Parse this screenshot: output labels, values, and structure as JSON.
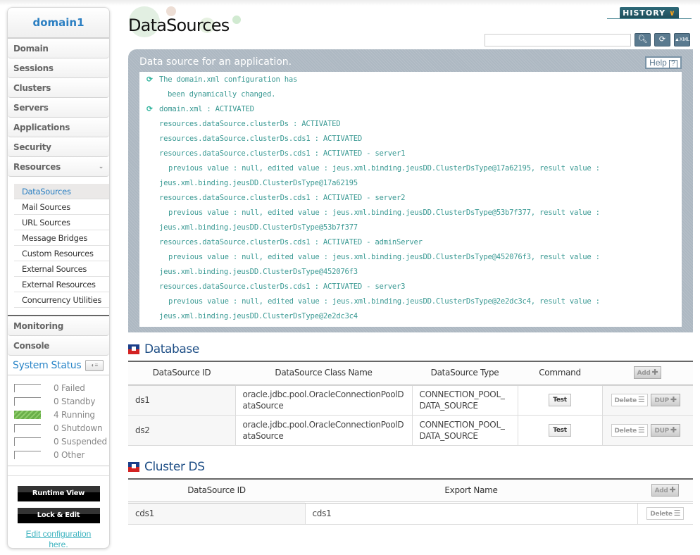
{
  "sidebar": {
    "domain": "domain1",
    "nav_top": [
      "Domain",
      "Sessions",
      "Clusters",
      "Servers",
      "Applications",
      "Security",
      "Resources"
    ],
    "resources_sub": [
      "DataSources",
      "Mail Sources",
      "URL Sources",
      "Message Bridges",
      "Custom Resources",
      "External Sources",
      "External Resources",
      "Concurrency Utilities"
    ],
    "active_sub": "DataSources",
    "nav_bottom": [
      "Monitoring",
      "Console"
    ],
    "system_status": {
      "title": "System Status",
      "rows": [
        {
          "count": 0,
          "label": "0 Failed"
        },
        {
          "count": 0,
          "label": "0 Standby"
        },
        {
          "count": 4,
          "label": "4 Running"
        },
        {
          "count": 0,
          "label": "0 Shutdown"
        },
        {
          "count": 0,
          "label": "0 Suspended"
        },
        {
          "count": 0,
          "label": "0 Other"
        }
      ]
    },
    "runtime_view": "Runtime View",
    "lock_edit": "Lock & Edit",
    "edit_link_1": "Edit configuration",
    "edit_link_2": "here."
  },
  "header": {
    "title": "DataSources",
    "history": "HISTORY",
    "search_value": ""
  },
  "info": {
    "title": "Data source for an application.",
    "help": "Help",
    "lines": [
      {
        "icon": true,
        "text": "The domain.xml configuration has"
      },
      {
        "icon": false,
        "indent": 2,
        "text": "been dynamically changed."
      },
      {
        "icon": true,
        "text": "domain.xml : ACTIVATED"
      },
      {
        "icon": false,
        "indent": 1,
        "text": "resources.dataSource.clusterDs : ACTIVATED"
      },
      {
        "icon": false,
        "indent": 1,
        "text": "resources.dataSource.clusterDs.cds1 : ACTIVATED"
      },
      {
        "icon": false,
        "indent": 1,
        "text": "resources.dataSource.clusterDs.cds1 : ACTIVATED - server1"
      },
      {
        "icon": false,
        "indent": 3,
        "text": "previous value : null, edited value : jeus.xml.binding.jeusDD.ClusterDsType@17a62195, result value :"
      },
      {
        "icon": false,
        "indent": 1,
        "text": "jeus.xml.binding.jeusDD.ClusterDsType@17a62195"
      },
      {
        "icon": false,
        "indent": 1,
        "text": "resources.dataSource.clusterDs.cds1 : ACTIVATED - server2"
      },
      {
        "icon": false,
        "indent": 3,
        "text": "previous value : null, edited value : jeus.xml.binding.jeusDD.ClusterDsType@53b7f377, result value :"
      },
      {
        "icon": false,
        "indent": 1,
        "text": "jeus.xml.binding.jeusDD.ClusterDsType@53b7f377"
      },
      {
        "icon": false,
        "indent": 1,
        "text": "resources.dataSource.clusterDs.cds1 : ACTIVATED - adminServer"
      },
      {
        "icon": false,
        "indent": 3,
        "text": "previous value : null, edited value : jeus.xml.binding.jeusDD.ClusterDsType@452076f3, result value :"
      },
      {
        "icon": false,
        "indent": 1,
        "text": "jeus.xml.binding.jeusDD.ClusterDsType@452076f3"
      },
      {
        "icon": false,
        "indent": 1,
        "text": "resources.dataSource.clusterDs.cds1 : ACTIVATED - server3"
      },
      {
        "icon": false,
        "indent": 3,
        "text": "previous value : null, edited value : jeus.xml.binding.jeusDD.ClusterDsType@2e2dc3c4, result value :"
      },
      {
        "icon": false,
        "indent": 1,
        "text": "jeus.xml.binding.jeusDD.ClusterDsType@2e2dc3c4"
      }
    ]
  },
  "database": {
    "title": "Database",
    "headers": [
      "DataSource ID",
      "DataSource Class Name",
      "DataSource Type",
      "Command"
    ],
    "add": "Add",
    "test": "Test",
    "delete": "Delete",
    "dup": "DUP",
    "rows": [
      {
        "id": "ds1",
        "class_name": "oracle.jdbc.pool.OracleConnectionPoolDataSource",
        "type": "CONNECTION_POOL_DATA_SOURCE"
      },
      {
        "id": "ds2",
        "class_name": "oracle.jdbc.pool.OracleConnectionPoolDataSource",
        "type": "CONNECTION_POOL_DATA_SOURCE"
      }
    ]
  },
  "cluster_ds": {
    "title": "Cluster DS",
    "headers": [
      "DataSource ID",
      "Export Name"
    ],
    "add": "Add",
    "delete": "Delete",
    "rows": [
      {
        "id": "cds1",
        "export_name": "cds1"
      }
    ]
  },
  "colors": {
    "accent_blue": "#2b86c8",
    "log_teal": "#3b9a94",
    "section_navy": "#1f4f86",
    "running_green": "#6aaf4a"
  }
}
